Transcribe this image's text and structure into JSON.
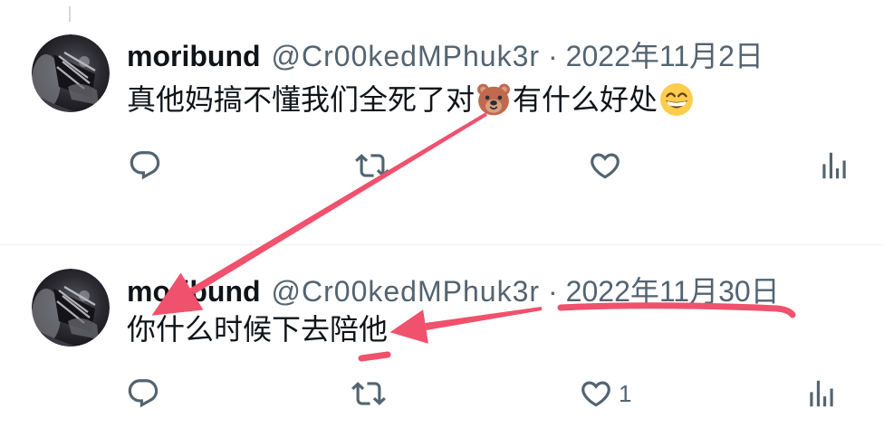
{
  "colors": {
    "text_primary": "#0f1419",
    "text_secondary": "#536471",
    "divider": "#eff3f4",
    "thread_line": "#cfd9de",
    "annotation": "#f0516d"
  },
  "icons": {
    "reply": "reply-icon",
    "retweet": "retweet-icon",
    "like": "heart-icon",
    "views": "analytics-icon"
  },
  "tweets": [
    {
      "author": {
        "name": "moribund",
        "handle": "@Cr00kedMPhuk3r"
      },
      "separator": "·",
      "date": "2022年11月2日",
      "body_text": [
        "真他妈搞不懂我们全死了对",
        "有什么好处"
      ],
      "body_emoji_icons": [
        "bear-face-emoji",
        "grinning-face-emoji"
      ]
    },
    {
      "author": {
        "name": "moribund",
        "handle": "@Cr00kedMPhuk3r"
      },
      "separator": "·",
      "date": "2022年11月30日",
      "body_text": [
        "你什么时候下去陪他"
      ],
      "stats": {
        "likes": "1"
      }
    }
  ]
}
